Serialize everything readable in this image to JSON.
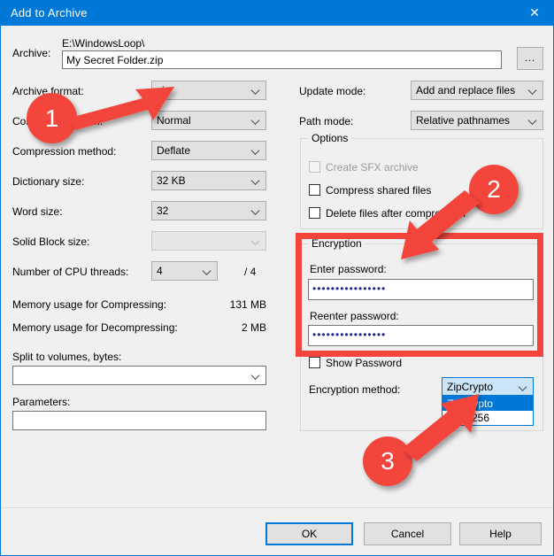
{
  "window": {
    "title": "Add to Archive",
    "close_icon": "close-icon",
    "accent_color": "#0078d7",
    "annotation_color": "#f4453c"
  },
  "archive": {
    "label": "Archive:",
    "path": "E:\\WindowsLoop\\",
    "filename": "My Secret Folder.zip",
    "browse_label": "...",
    "browse_icon": "ellipsis-icon"
  },
  "left": {
    "rows": [
      {
        "label": "Archive format:",
        "value": "zip",
        "disabled": false
      },
      {
        "label": "Compression level:",
        "value": "Normal",
        "disabled": false
      },
      {
        "label": "Compression method:",
        "value": "Deflate",
        "disabled": false
      },
      {
        "label": "Dictionary size:",
        "value": "32 KB",
        "disabled": false
      },
      {
        "label": "Word size:",
        "value": "32",
        "disabled": false
      },
      {
        "label": "Solid Block size:",
        "value": "",
        "disabled": true
      }
    ],
    "cpu_threads": {
      "label": "Number of CPU threads:",
      "value": "4",
      "max": "/ 4"
    },
    "mem_compress": {
      "label": "Memory usage for Compressing:",
      "value": "131 MB"
    },
    "mem_decompress": {
      "label": "Memory usage for Decompressing:",
      "value": "2 MB"
    },
    "split": {
      "label": "Split to volumes, bytes:",
      "value": ""
    },
    "parameters": {
      "label": "Parameters:",
      "value": ""
    }
  },
  "right": {
    "update_mode": {
      "label": "Update mode:",
      "value": "Add and replace files"
    },
    "path_mode": {
      "label": "Path mode:",
      "value": "Relative pathnames"
    },
    "options": {
      "title": "Options",
      "items": [
        {
          "label": "Create SFX archive",
          "checked": false,
          "disabled": true
        },
        {
          "label": "Compress shared files",
          "checked": false,
          "disabled": false
        },
        {
          "label": "Delete files after compression",
          "checked": false,
          "disabled": false
        }
      ]
    },
    "encryption": {
      "title": "Encryption",
      "enter_password_label": "Enter password:",
      "enter_password_value": "••••••••••••••••",
      "reenter_password_label": "Reenter password:",
      "reenter_password_value": "••••••••••••••••",
      "show_password_label": "Show Password",
      "method_label": "Encryption method:",
      "method_value": "ZipCrypto",
      "method_options": [
        "ZipCrypto",
        "AES-256"
      ],
      "method_selected_index": 0
    }
  },
  "footer": {
    "ok": "OK",
    "cancel": "Cancel",
    "help": "Help"
  },
  "annotations": {
    "badge1": "1",
    "badge2": "2",
    "badge3": "3"
  }
}
